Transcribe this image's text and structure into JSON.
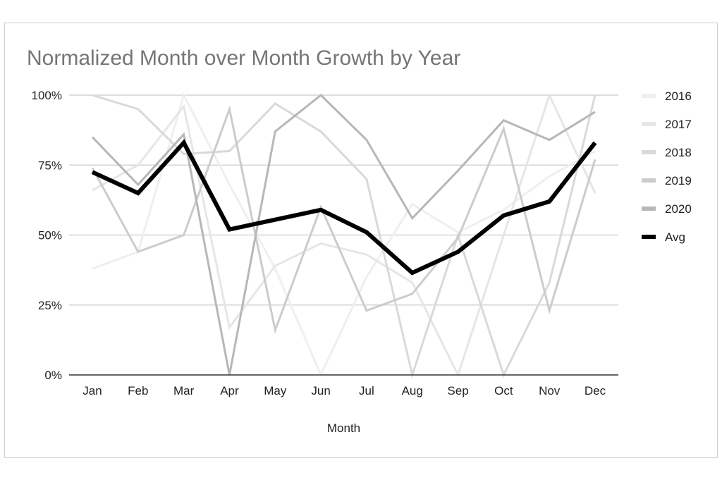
{
  "chart_data": {
    "type": "line",
    "title": "Normalized Month over Month Growth by Year",
    "xlabel": "Month",
    "ylabel": "",
    "categories": [
      "Jan",
      "Feb",
      "Mar",
      "Apr",
      "May",
      "Jun",
      "Jul",
      "Aug",
      "Sep",
      "Oct",
      "Nov",
      "Dec"
    ],
    "ylim": [
      0,
      100
    ],
    "yticks": [
      0,
      25,
      50,
      75,
      100
    ],
    "ytick_labels": [
      "0%",
      "25%",
      "50%",
      "75%",
      "100%"
    ],
    "grid": true,
    "legend_position": "right",
    "series": [
      {
        "name": "2016",
        "color": "#efefef",
        "values": [
          38,
          44,
          100,
          68,
          38,
          0,
          35,
          61,
          51,
          59,
          71,
          80
        ]
      },
      {
        "name": "2017",
        "color": "#e6e6e6",
        "values": [
          66,
          75,
          96,
          17,
          39,
          47,
          43,
          33,
          0,
          50,
          100,
          65
        ]
      },
      {
        "name": "2018",
        "color": "#d9d9d9",
        "values": [
          100,
          95,
          79,
          80,
          97,
          87,
          70,
          0,
          50,
          0,
          33,
          100
        ]
      },
      {
        "name": "2019",
        "color": "#cccccc",
        "values": [
          74,
          44,
          50,
          95,
          16,
          60,
          23,
          29,
          49,
          88,
          23,
          77
        ]
      },
      {
        "name": "2020",
        "color": "#b7b7b7",
        "values": [
          85,
          68,
          86,
          0,
          87,
          100,
          84,
          56,
          73,
          91,
          84,
          94
        ]
      },
      {
        "name": "Avg",
        "color": "#000000",
        "values": [
          72.5,
          65,
          83,
          52,
          55.5,
          59,
          51,
          36.5,
          44,
          57,
          62,
          83
        ]
      }
    ]
  }
}
